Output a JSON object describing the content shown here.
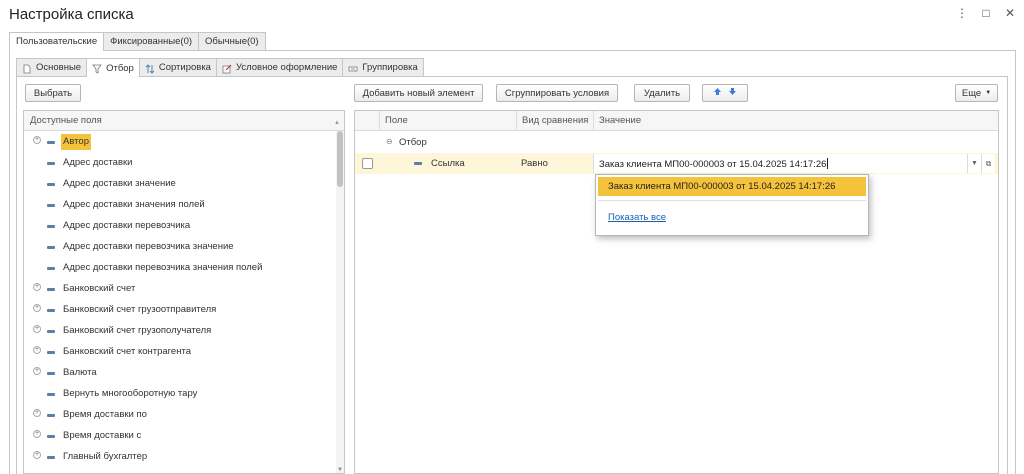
{
  "window": {
    "title": "Настройка списка",
    "menu_glyph": "⋮",
    "maximize_glyph": "□",
    "close_glyph": "✕"
  },
  "outer_tabs": [
    {
      "label": "Пользовательские",
      "active": true
    },
    {
      "label": "Фиксированные(0)",
      "active": false
    },
    {
      "label": "Обычные(0)",
      "active": false
    }
  ],
  "inner_tabs": [
    {
      "label": "Основные",
      "icon": "page-icon",
      "active": false
    },
    {
      "label": "Отбор",
      "icon": "filter-icon",
      "active": true
    },
    {
      "label": "Сортировка",
      "icon": "sort-icon",
      "active": false
    },
    {
      "label": "Условное оформление",
      "icon": "brush-icon",
      "active": false
    },
    {
      "label": "Группировка",
      "icon": "grouping-icon",
      "active": false
    }
  ],
  "toolbar": {
    "select_label": "Выбрать",
    "add_label": "Добавить новый элемент",
    "group_label": "Сгруппировать условия",
    "delete_label": "Удалить",
    "more_label": "Еще"
  },
  "fields": {
    "header": "Доступные поля",
    "items": [
      {
        "label": "Автор",
        "expandable": true,
        "selected": true
      },
      {
        "label": "Адрес доставки",
        "expandable": false,
        "selected": false
      },
      {
        "label": "Адрес доставки значение",
        "expandable": false,
        "selected": false
      },
      {
        "label": "Адрес доставки значения полей",
        "expandable": false,
        "selected": false
      },
      {
        "label": "Адрес доставки перевозчика",
        "expandable": false,
        "selected": false
      },
      {
        "label": "Адрес доставки перевозчика значение",
        "expandable": false,
        "selected": false
      },
      {
        "label": "Адрес доставки перевозчика значения полей",
        "expandable": false,
        "selected": false
      },
      {
        "label": "Банковский счет",
        "expandable": true,
        "selected": false
      },
      {
        "label": "Банковский счет грузоотправителя",
        "expandable": true,
        "selected": false
      },
      {
        "label": "Банковский счет грузополучателя",
        "expandable": true,
        "selected": false
      },
      {
        "label": "Банковский счет контрагента",
        "expandable": true,
        "selected": false
      },
      {
        "label": "Валюта",
        "expandable": true,
        "selected": false
      },
      {
        "label": "Вернуть многооборотную тару",
        "expandable": false,
        "selected": false
      },
      {
        "label": "Время доставки по",
        "expandable": true,
        "selected": false
      },
      {
        "label": "Время доставки с",
        "expandable": true,
        "selected": false
      },
      {
        "label": "Главный бухгалтер",
        "expandable": true,
        "selected": false
      }
    ]
  },
  "grid": {
    "columns": {
      "field": "Поле",
      "comparison": "Вид сравнения",
      "value": "Значение"
    },
    "group_label": "Отбор",
    "row": {
      "field": "Ссылка",
      "comparison": "Равно",
      "value": "Заказ клиента МП00-000003 от 15.04.2025 14:17:26"
    }
  },
  "popup": {
    "item": "Заказ клиента МП00-000003 от 15.04.2025 14:17:26",
    "show_all": "Показать все"
  },
  "colors": {
    "selection": "#f5c33b",
    "row_highlight": "#fdf6d8",
    "link": "#1a5fb4",
    "arrow_blue": "#3b7dd8"
  }
}
